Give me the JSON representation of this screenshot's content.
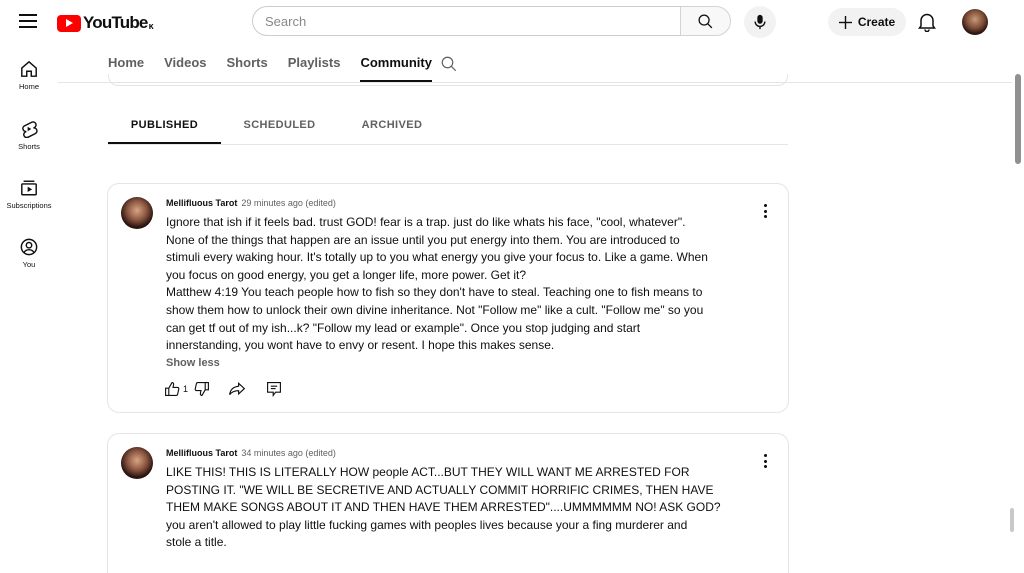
{
  "header": {
    "logo_text": "YouTube",
    "logo_suffix": "ĸ",
    "search_placeholder": "Search",
    "create_label": "Create"
  },
  "sidebar": {
    "items": [
      {
        "label": "Home",
        "icon": "home-icon"
      },
      {
        "label": "Shorts",
        "icon": "shorts-icon"
      },
      {
        "label": "Subscriptions",
        "icon": "subscriptions-icon"
      },
      {
        "label": "You",
        "icon": "you-icon"
      }
    ]
  },
  "channel_tabs": [
    "Home",
    "Videos",
    "Shorts",
    "Playlists",
    "Community"
  ],
  "channel_tabs_active": "Community",
  "post_tabs": [
    "PUBLISHED",
    "SCHEDULED",
    "ARCHIVED"
  ],
  "post_tabs_active": "PUBLISHED",
  "posts": [
    {
      "author": "Mellifluous Tarot",
      "time": "29 minutes ago (edited)",
      "lines": [
        "Ignore that ish if it feels bad. trust GOD! fear is a trap. just do like whats his face, \"cool, whatever\".",
        "None of the things that happen are an issue until you put energy into them. You are introduced to",
        "stimuli every waking hour. It's totally up to you what energy you give your focus to. Like a game. When",
        "you focus on good energy, you get a longer life, more power. Get it?",
        "Matthew 4:19 You teach people how to fish so they don't have to steal. Teaching one to fish means to",
        "show them how to unlock their own divine inheritance. Not \"Follow me\" like a cult. \"Follow me\" so you",
        "can get tf out of my ish...k? \"Follow my lead or example\". Once you stop judging and start",
        "innerstanding, you wont have to envy or resent. I hope this makes sense."
      ],
      "show_less": "Show less",
      "like_count": "1"
    },
    {
      "author": "Mellifluous Tarot",
      "time": "34 minutes ago (edited)",
      "lines": [
        "LIKE THIS! THIS IS LITERALLY HOW people ACT...BUT THEY WILL WANT ME ARRESTED FOR",
        "POSTING IT. \"WE WILL BE SECRETIVE AND ACTUALLY COMMIT HORRIFIC CRIMES, THEN HAVE",
        "THEM MAKE SONGS ABOUT IT AND THEN HAVE THEM ARRESTED\"....UMMMMMM NO! ASK GOD?",
        "you aren't allowed to play little fucking games with peoples lives because your a fing murderer and",
        "stole a title."
      ]
    }
  ]
}
